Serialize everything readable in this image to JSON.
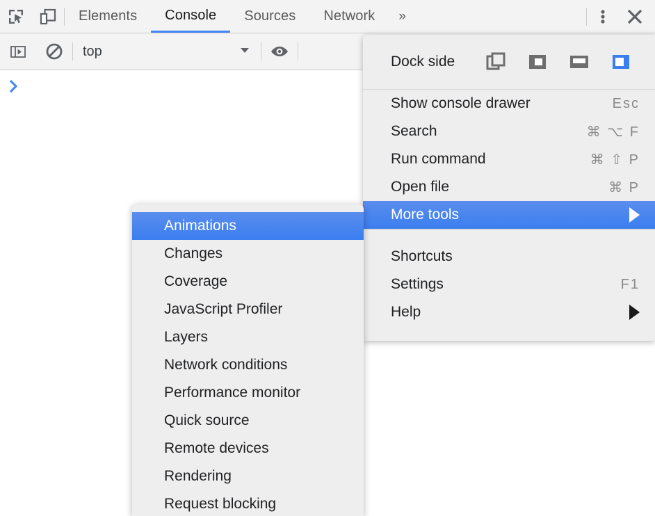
{
  "tabbar": {
    "inspect_icon": "inspect-element-icon",
    "device_icon": "device-toolbar-icon",
    "tabs": [
      {
        "label": "Elements",
        "selected": false
      },
      {
        "label": "Console",
        "selected": true
      },
      {
        "label": "Sources",
        "selected": false
      },
      {
        "label": "Network",
        "selected": false
      }
    ],
    "more_tabs_label": "»",
    "menu_icon": "three-dot-menu-icon",
    "close_icon": "close-icon"
  },
  "console_toolbar": {
    "sidebar_icon": "console-sidebar-icon",
    "clear_icon": "clear-console-icon",
    "context": {
      "value": "top",
      "caret": "▼"
    },
    "eye_icon": "live-expression-eye-icon"
  },
  "console_body": {
    "prompt_chevron": "❯"
  },
  "main_menu": {
    "dock_side": {
      "label": "Dock side",
      "options": [
        {
          "name": "undock-into-separate-window",
          "selected": false
        },
        {
          "name": "dock-to-left",
          "selected": false
        },
        {
          "name": "dock-to-bottom",
          "selected": false
        },
        {
          "name": "dock-to-right",
          "selected": true
        }
      ],
      "selected_color": "#3b7ef0",
      "icon_color": "#6e6e6e"
    },
    "items": [
      {
        "label": "Show console drawer",
        "shortcut": "Esc",
        "highlight": false,
        "arrow": false
      },
      {
        "label": "Search",
        "shortcut": "⌘ ⌥ F",
        "highlight": false,
        "arrow": false
      },
      {
        "label": "Run command",
        "shortcut": "⌘ ⇧ P",
        "highlight": false,
        "arrow": false
      },
      {
        "label": "Open file",
        "shortcut": "⌘ P",
        "highlight": false,
        "arrow": false
      },
      {
        "label": "More tools",
        "shortcut": "",
        "highlight": true,
        "arrow": true
      },
      {
        "label": "Shortcuts",
        "shortcut": "",
        "highlight": false,
        "arrow": false
      },
      {
        "label": "Settings",
        "shortcut": "F1",
        "highlight": false,
        "arrow": false
      },
      {
        "label": "Help",
        "shortcut": "",
        "highlight": false,
        "arrow": true
      }
    ]
  },
  "more_tools_submenu": {
    "items": [
      {
        "label": "Animations",
        "highlight": true
      },
      {
        "label": "Changes",
        "highlight": false
      },
      {
        "label": "Coverage",
        "highlight": false
      },
      {
        "label": "JavaScript Profiler",
        "highlight": false
      },
      {
        "label": "Layers",
        "highlight": false
      },
      {
        "label": "Network conditions",
        "highlight": false
      },
      {
        "label": "Performance monitor",
        "highlight": false
      },
      {
        "label": "Quick source",
        "highlight": false
      },
      {
        "label": "Remote devices",
        "highlight": false
      },
      {
        "label": "Rendering",
        "highlight": false
      },
      {
        "label": "Request blocking",
        "highlight": false
      }
    ]
  },
  "colors": {
    "accent": "#3b7ef0",
    "panel_bg": "#eeeeee",
    "toolbar_bg": "#f3f3f3",
    "text": "#202124",
    "muted_text": "#8a8a8a"
  }
}
